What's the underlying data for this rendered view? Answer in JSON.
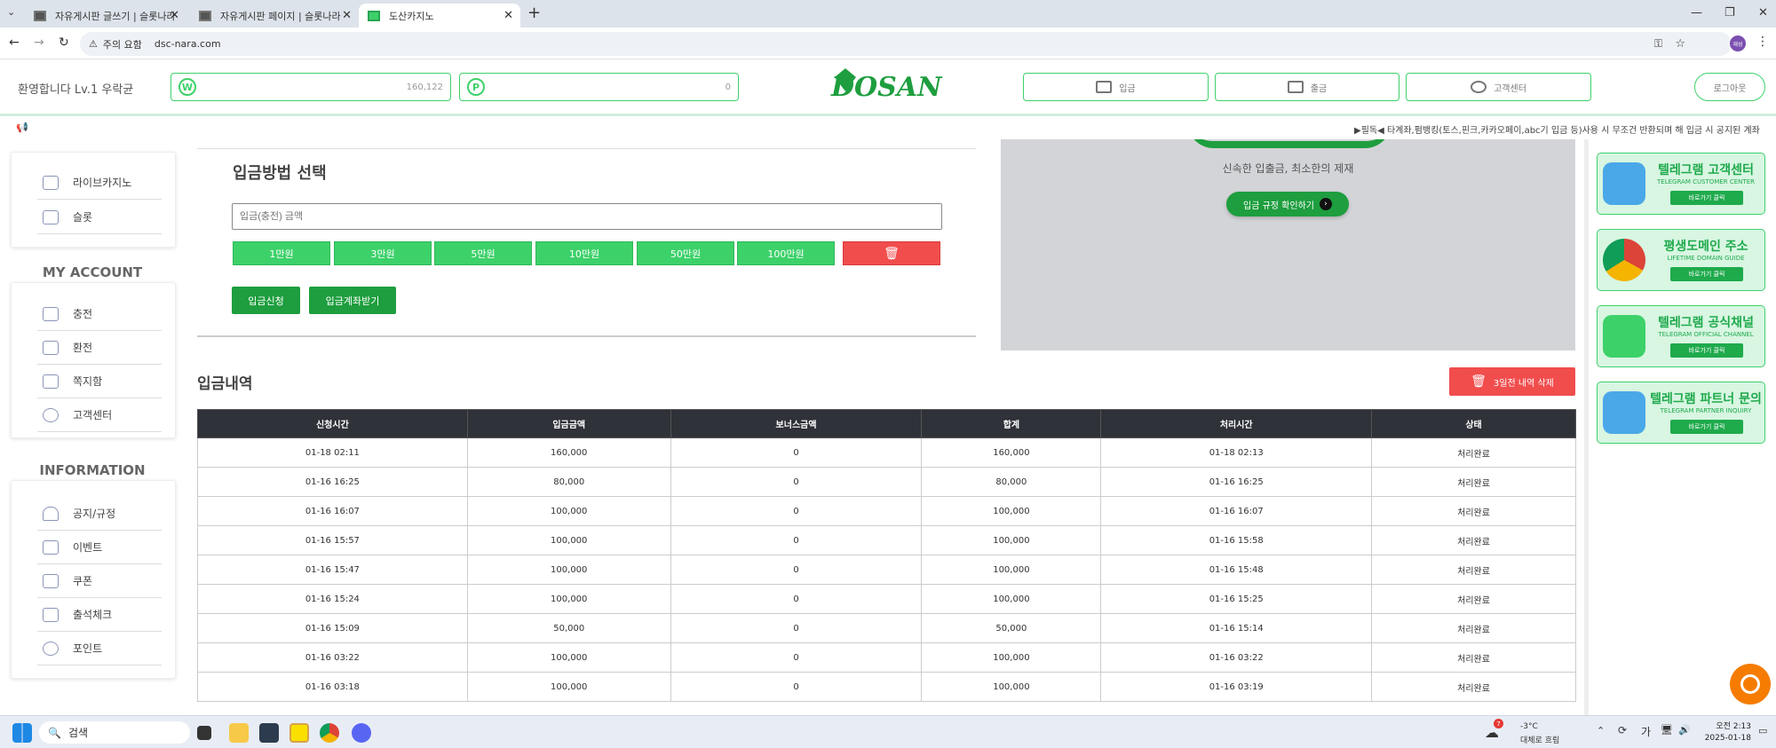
{
  "browser": {
    "tabs": [
      {
        "title": "자유게시판 글쓰기 | 슬롯나라"
      },
      {
        "title": "자유게시판 페이지 | 슬롯나라"
      },
      {
        "title": "도산카지노"
      }
    ],
    "security_label": "주의 요함",
    "url": "dsc-nara.com",
    "profile_label": "재성"
  },
  "header": {
    "welcome": "환영합니다 Lv.1 우락균",
    "wallet_coin": "W",
    "wallet_balance": "160,122",
    "point_coin": "P",
    "point_balance": "0",
    "logo_text": "DOSAN",
    "deposit_label": "입금",
    "withdraw_label": "출금",
    "support_label": "고객센터",
    "logout_label": "로그아웃"
  },
  "marquee": {
    "text": "▶필독◀ 타계좌,펌뱅킹(토스,핀크,카카오페이,abc기 입금 등)사용 시 무조건 반환되며 해 입금 시 공지된 계좌"
  },
  "sidebar": {
    "top_items": [
      {
        "label": "라이브카지노",
        "icon": "casino-card-icon"
      },
      {
        "label": "슬롯",
        "icon": "slot-machine-icon"
      }
    ],
    "my_account_title": "MY ACCOUNT",
    "account_items": [
      {
        "label": "충전",
        "icon": "wallet-icon"
      },
      {
        "label": "환전",
        "icon": "card-icon"
      },
      {
        "label": "쪽지함",
        "icon": "message-icon"
      },
      {
        "label": "고객센터",
        "icon": "headset-icon"
      }
    ],
    "information_title": "INFORMATION",
    "info_items": [
      {
        "label": "공지/규정",
        "icon": "bell-icon"
      },
      {
        "label": "이벤트",
        "icon": "gift-icon"
      },
      {
        "label": "쿠폰",
        "icon": "coupon-icon"
      },
      {
        "label": "출석체크",
        "icon": "calendar-icon"
      },
      {
        "label": "포인트",
        "icon": "point-icon"
      }
    ]
  },
  "deposit": {
    "title": "입금방법 선택",
    "amount_placeholder": "입금(충전) 금액",
    "amount_buttons": [
      "1만원",
      "3만원",
      "5만원",
      "10만원",
      "50만원",
      "100만원"
    ],
    "apply_label": "입금신청",
    "account_label": "입금계좌받기"
  },
  "banner": {
    "subtitle": "신속한 입출금, 최소한의 제재",
    "rules_button": "입금 규정 확인하기"
  },
  "history": {
    "title": "입금내역",
    "delete_label": "3일전 내역 삭제",
    "columns": [
      "신청시간",
      "입금금액",
      "보너스금액",
      "합계",
      "처리시간",
      "상태"
    ],
    "rows": [
      [
        "01-18 02:11",
        "160,000",
        "0",
        "160,000",
        "01-18 02:13",
        "처리완료"
      ],
      [
        "01-16 16:25",
        "80,000",
        "0",
        "80,000",
        "01-16 16:25",
        "처리완료"
      ],
      [
        "01-16 16:07",
        "100,000",
        "0",
        "100,000",
        "01-16 16:07",
        "처리완료"
      ],
      [
        "01-16 15:57",
        "100,000",
        "0",
        "100,000",
        "01-16 15:58",
        "처리완료"
      ],
      [
        "01-16 15:47",
        "100,000",
        "0",
        "100,000",
        "01-16 15:48",
        "처리완료"
      ],
      [
        "01-16 15:24",
        "100,000",
        "0",
        "100,000",
        "01-16 15:25",
        "처리완료"
      ],
      [
        "01-16 15:09",
        "50,000",
        "0",
        "50,000",
        "01-16 15:14",
        "처리완료"
      ],
      [
        "01-16 03:22",
        "100,000",
        "0",
        "100,000",
        "01-16 03:22",
        "처리완료"
      ],
      [
        "01-16 03:18",
        "100,000",
        "0",
        "100,000",
        "01-16 03:19",
        "처리완료"
      ]
    ]
  },
  "promos": [
    {
      "title": "텔레그램 고객센터",
      "sub": "TELEGRAM CUSTOMER CENTER",
      "button": "바로가기 클릭",
      "icon": "telegram-icon"
    },
    {
      "title": "평생도메인 주소",
      "sub": "LIFETIME DOMAIN GUIDE",
      "button": "바로가기 클릭",
      "icon": "chrome-icon"
    },
    {
      "title": "텔레그램 공식채널",
      "sub": "TELEGRAM OFFICIAL CHANNEL",
      "button": "바로가기 클릭",
      "icon": "telegram-icon"
    },
    {
      "title": "텔레그램 파트너 문의",
      "sub": "TELEGRAM PARTNER INQUIRY",
      "button": "바로가기 클릭",
      "icon": "telegram-icon"
    }
  ],
  "taskbar": {
    "search_label": "검색",
    "weather_badge": "7",
    "temperature": "-3°C",
    "weather_text": "대체로 흐림",
    "ime_label": "가",
    "time": "오전 2:13",
    "date": "2025-01-18"
  }
}
